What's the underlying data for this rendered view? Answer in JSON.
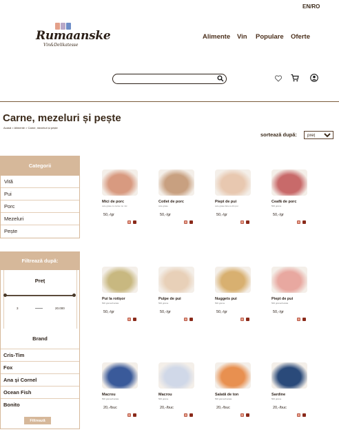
{
  "header": {
    "lang": "EN/RO",
    "logo_text": "Rumaanske",
    "logo_sub": "Vin&Delikatesse",
    "logo_colors": [
      "#e3a08a",
      "#b8a8c8",
      "#6e8ec8"
    ],
    "nav": [
      "Alimente",
      "Vin",
      "Populare",
      "Oferte"
    ],
    "search_placeholder": ""
  },
  "icons": [
    "search-icon",
    "heart-icon",
    "cart-icon",
    "user-icon"
  ],
  "page": {
    "title": "Carne, mezeluri și pește",
    "breadcrumb": "Acasă > Alimente > Carne, mezeluri și pește",
    "sort_label": "sortează după:",
    "sort_value": "preț"
  },
  "categories": {
    "title": "Categorii",
    "items": [
      "Vită",
      "Pui",
      "Porc",
      "Mezeluri",
      "Pește"
    ]
  },
  "filter": {
    "title": "Filtrează după:",
    "price_title": "Preț",
    "price_min": "3",
    "price_max": "20.000",
    "brand_title": "Brand",
    "brands": [
      "Cris-Tim",
      "Fox",
      "Ana și Cornel",
      "Ocean Fish",
      "Bonito"
    ],
    "button": "Filtrează"
  },
  "products": [
    {
      "name": "Mici de porc",
      "sub": "cele grase cu carne mo mic",
      "price": "50,-/gr",
      "color": "#d89a80"
    },
    {
      "name": "Cotlet de porc",
      "sub": "cele grase",
      "price": "50,-/gr",
      "color": "#c8a080"
    },
    {
      "name": "Piept de pui",
      "sub": "cele grase fara os din pui",
      "price": "50,-/gr",
      "color": "#e8c8b0"
    },
    {
      "name": "Ceafă de porc",
      "sub": "500 grame",
      "price": "50,-/gr",
      "color": "#c86a6a"
    },
    {
      "name": "Pui la rotișor",
      "sub": "500 grame/bucata",
      "price": "50,-/gr",
      "color": "#c8b880"
    },
    {
      "name": "Pulpe de pui",
      "sub": "500 grame",
      "price": "50,-/gr",
      "color": "#e8d0b8"
    },
    {
      "name": "Nuggets pui",
      "sub": "500 grame",
      "price": "50,-/gr",
      "color": "#d8b070"
    },
    {
      "name": "Piept de pui",
      "sub": "500 grame/bucata",
      "price": "50,-/gr",
      "color": "#e8a8a0"
    },
    {
      "name": "Macrou",
      "sub": "500 grame/bucata",
      "price": "20,-/buc",
      "color": "#3a5a9a"
    },
    {
      "name": "Macrou",
      "sub": "500 grame",
      "price": "20,-/buc",
      "color": "#d0d8e8"
    },
    {
      "name": "Salată de ton",
      "sub": "500 grame/bucata",
      "price": "20,-/buc",
      "color": "#e89050"
    },
    {
      "name": "Sardine",
      "sub": "500 grame",
      "price": "20,-/buc",
      "color": "#2a4a7a"
    }
  ]
}
